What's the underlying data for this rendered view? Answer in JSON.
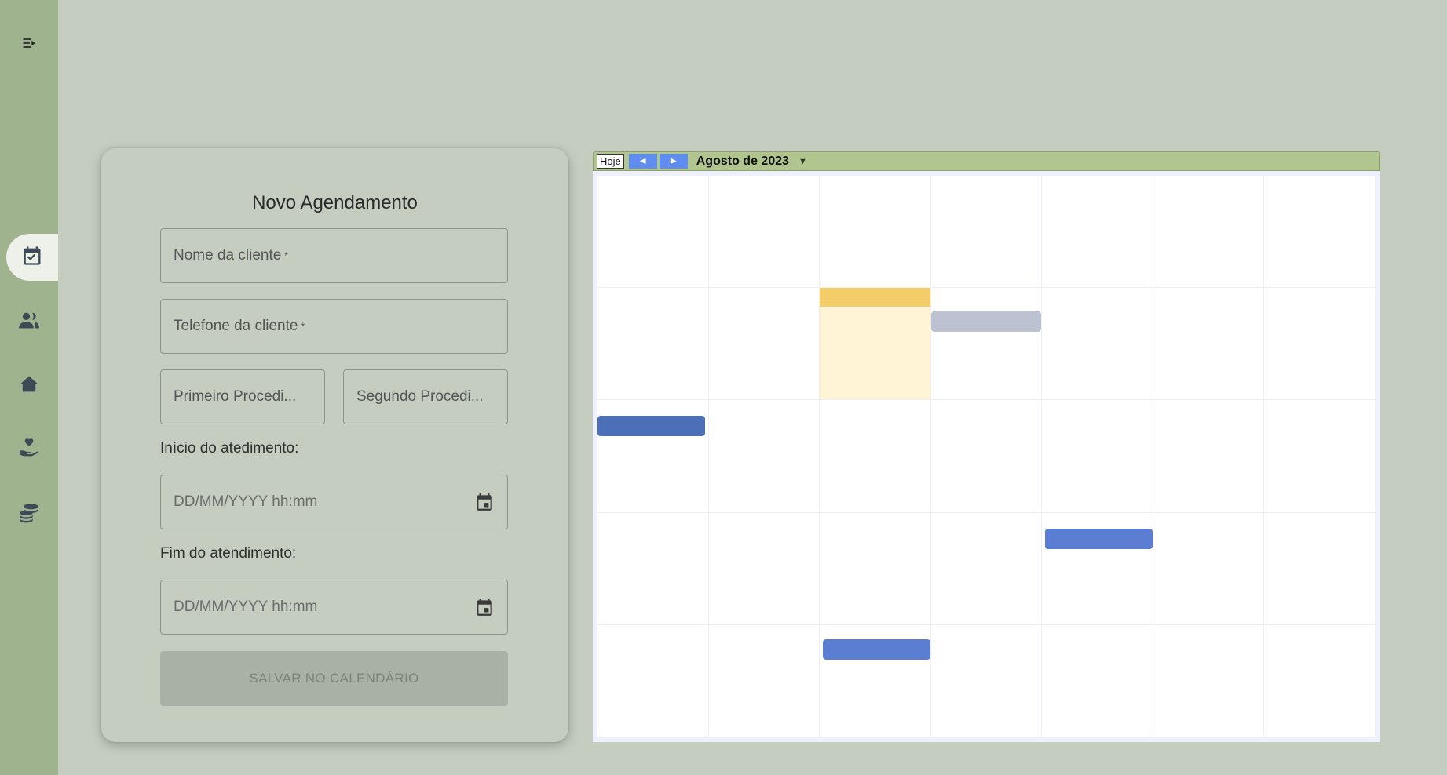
{
  "sidebar": {
    "menu_icon": "menu-toggle-icon",
    "items": [
      {
        "name": "calendar",
        "icon": "calendar-check-icon",
        "active": true
      },
      {
        "name": "clients",
        "icon": "users-icon",
        "active": false
      },
      {
        "name": "home",
        "icon": "home-icon",
        "active": false
      },
      {
        "name": "care",
        "icon": "hand-heart-icon",
        "active": false
      },
      {
        "name": "finance",
        "icon": "coins-icon",
        "active": false
      }
    ]
  },
  "form": {
    "title": "Novo Agendamento",
    "client_name_label": "Nome da cliente",
    "client_phone_label": "Telefone da cliente",
    "required_mark": "*",
    "first_procedure_label": "Primeiro Procedi...",
    "second_procedure_label": "Segundo Procedi...",
    "start_label": "Início do atedimento:",
    "start_placeholder": "DD/MM/YYYY hh:mm",
    "end_label": "Fim do atendimento:",
    "end_placeholder": "DD/MM/YYYY hh:mm",
    "save_label": "SALVAR NO CALENDÁRIO"
  },
  "calendar": {
    "today_label": "Hoje",
    "month_label": "Agosto de 2023",
    "colors": {
      "toolbar": "#b1c68e",
      "today": "#fff4d6",
      "event_blue": "#5c7ed2",
      "event_gray": "#bcc2d2"
    }
  }
}
